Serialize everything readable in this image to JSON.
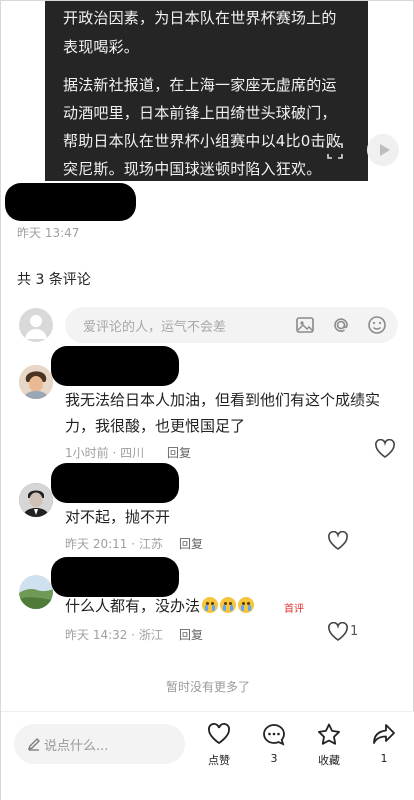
{
  "post": {
    "lines": [
      "开政治因素，为日本队在世界杯赛场上的",
      "表现喝彩。",
      "据法新社报道，在上海一家座无虚席的运",
      "动酒吧里，日本前锋上田绮世头球破门，",
      "帮助日本队在世界杯小组赛中以4比0击败",
      "突尼斯。现场中国球迷顿时陷入狂欢。"
    ],
    "time": "昨天 13:47"
  },
  "comments_header": "共 3 条评论",
  "comment_input": {
    "placeholder": "爱评论的人，运气不会差"
  },
  "comments": [
    {
      "text_line1": "我无法给日本人加油，但看到他们有这个成绩实",
      "text_line2": "力，我很酸，也更恨国足了",
      "meta": "1小时前 · 四川",
      "reply": "回复"
    },
    {
      "text_line1": "对不起，抛不开",
      "meta": "昨天 20:11 · 江苏",
      "reply": "回复"
    },
    {
      "text_line1": "什么人都有，没办法",
      "badge": "首评",
      "meta": "昨天 14:32 · 浙江",
      "reply": "回复",
      "like_count": "1"
    }
  ],
  "no_more": "暂时没有更多了",
  "bottom_bar": {
    "placeholder": "说点什么...",
    "like_label": "点赞",
    "comment_count": "3",
    "favorite_label": "收藏",
    "share_count": "1"
  },
  "icons": [
    "play-icon",
    "scan-icon",
    "image-icon",
    "at-icon",
    "emoji-icon",
    "heart-icon",
    "pencil-icon",
    "comment-icon",
    "star-icon",
    "share-icon"
  ]
}
